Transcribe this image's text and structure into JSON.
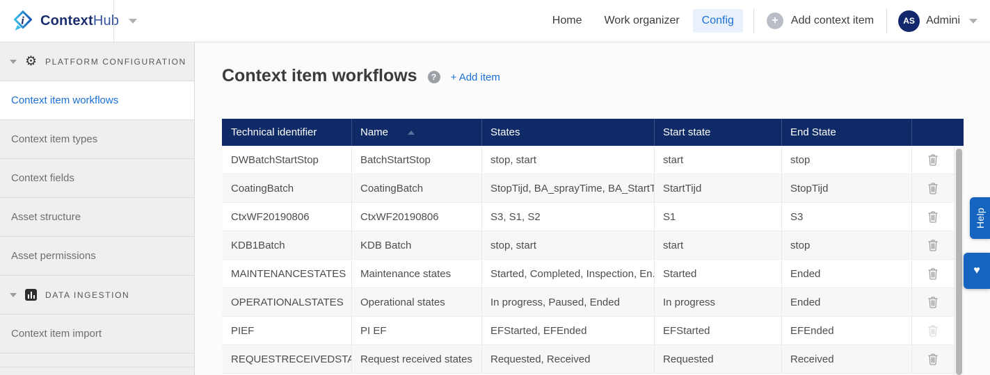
{
  "topbar": {
    "brand": {
      "bold": "Context",
      "light": "Hub"
    },
    "nav": [
      {
        "label": "Home",
        "active": false
      },
      {
        "label": "Work organizer",
        "active": false
      },
      {
        "label": "Config",
        "active": true
      }
    ],
    "add_context_item": "Add context item",
    "user": {
      "initials": "AS",
      "name": "Admini"
    }
  },
  "sidebar": {
    "sections": [
      {
        "title": "PLATFORM CONFIGURATION",
        "icon": "gear-icon",
        "items": [
          {
            "label": "Context item workflows",
            "selected": true
          },
          {
            "label": "Context item types",
            "selected": false
          },
          {
            "label": "Context fields",
            "selected": false
          },
          {
            "label": "Asset structure",
            "selected": false
          },
          {
            "label": "Asset permissions",
            "selected": false
          }
        ]
      },
      {
        "title": "DATA INGESTION",
        "icon": "bar-chart-icon",
        "items": [
          {
            "label": "Context item import",
            "selected": false
          }
        ]
      }
    ]
  },
  "page": {
    "title": "Context item workflows",
    "help_glyph": "?",
    "add_item": "+ Add item"
  },
  "table": {
    "columns": [
      {
        "label": "Technical identifier",
        "sorted": false
      },
      {
        "label": "Name",
        "sorted": true
      },
      {
        "label": "States",
        "sorted": false
      },
      {
        "label": "Start state",
        "sorted": false
      },
      {
        "label": "End State",
        "sorted": false
      }
    ],
    "sort_direction": "asc",
    "rows": [
      {
        "technical_identifier": "DWBatchStartStop",
        "name": "BatchStartStop",
        "states": "stop, start",
        "start_state": "start",
        "end_state": "stop",
        "delete_disabled": false
      },
      {
        "technical_identifier": "CoatingBatch",
        "name": "CoatingBatch",
        "states": "StopTijd, BA_sprayTime, BA_StartTi...",
        "start_state": "StartTijd",
        "end_state": "StopTijd",
        "delete_disabled": false
      },
      {
        "technical_identifier": "CtxWF20190806",
        "name": "CtxWF20190806",
        "states": "S3, S1, S2",
        "start_state": "S1",
        "end_state": "S3",
        "delete_disabled": false
      },
      {
        "technical_identifier": "KDB1Batch",
        "name": "KDB Batch",
        "states": "stop, start",
        "start_state": "start",
        "end_state": "stop",
        "delete_disabled": false
      },
      {
        "technical_identifier": "MAINTENANCESTATES",
        "name": "Maintenance states",
        "states": "Started, Completed, Inspection, En...",
        "start_state": "Started",
        "end_state": "Ended",
        "delete_disabled": false
      },
      {
        "technical_identifier": "OPERATIONALSTATES",
        "name": "Operational states",
        "states": "In progress, Paused, Ended",
        "start_state": "In progress",
        "end_state": "Ended",
        "delete_disabled": false
      },
      {
        "technical_identifier": "PIEF",
        "name": "PI EF",
        "states": "EFStarted, EFEnded",
        "start_state": "EFStarted",
        "end_state": "EFEnded",
        "delete_disabled": true
      },
      {
        "technical_identifier": "REQUESTRECEIVEDSTA...",
        "name": "Request received states",
        "states": "Requested, Received",
        "start_state": "Requested",
        "end_state": "Received",
        "delete_disabled": false
      }
    ]
  },
  "right_rail": {
    "help_label": "Help",
    "heart_glyph": "♥"
  },
  "icons": {
    "gear": "⚙",
    "plus": "+"
  },
  "colors": {
    "accent_blue": "#1a6fd4",
    "table_header_navy": "#0e2a67",
    "help_tab_blue": "#1565c0",
    "avatar_navy": "#13286c",
    "sidebar_gray": "#efefef"
  }
}
